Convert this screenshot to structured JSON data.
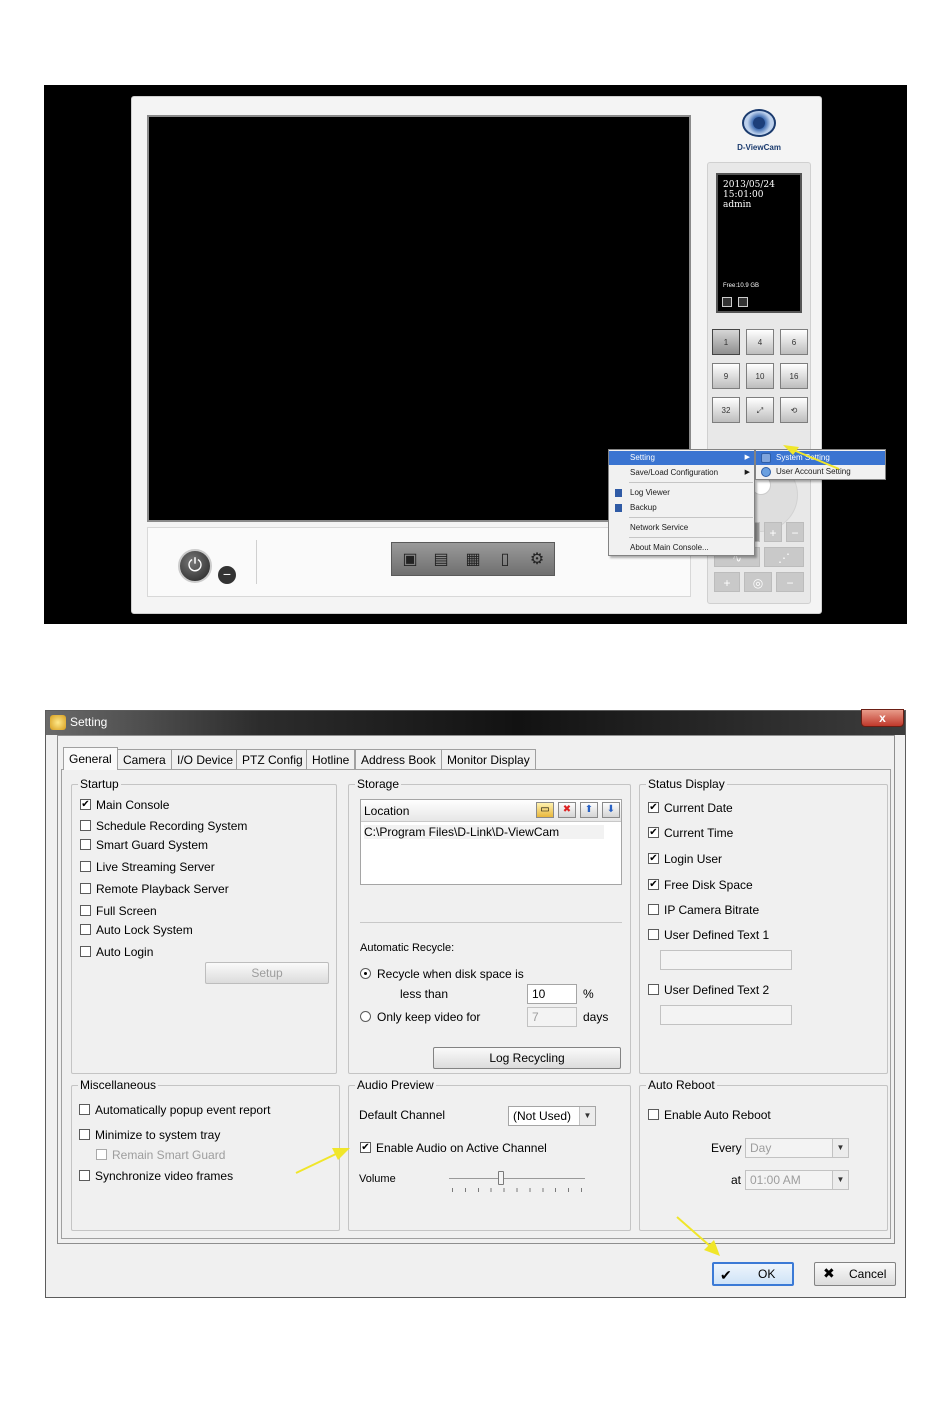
{
  "console": {
    "logo_text": "D-ViewCam",
    "info": {
      "date": "2013/05/24",
      "time": "15:01:00",
      "user": "admin",
      "free_space": "Free:10.9 GB"
    },
    "layout_buttons": [
      "1",
      "4",
      "6",
      "9",
      "10",
      "16",
      "32",
      "",
      ""
    ],
    "power_icon": "power-icon",
    "toolbar_icons": [
      "record-playback-icon",
      "clapperboard-icon",
      "schedule-icon",
      "document-icon",
      "gear-icon"
    ]
  },
  "context_menu": {
    "items": [
      {
        "label": "Setting",
        "submenu": true
      },
      {
        "label": "Save/Load Configuration",
        "submenu": true
      },
      {
        "label": "Log Viewer",
        "icon": "log-icon"
      },
      {
        "label": "Backup",
        "icon": "backup-icon"
      },
      {
        "label": "Network Service"
      },
      {
        "label": "About Main Console..."
      }
    ],
    "submenu": [
      "System Setting",
      "User Account Setting"
    ]
  },
  "dialog": {
    "title": "Setting",
    "close_label": "x",
    "tabs": [
      "General",
      "Camera",
      "I/O Device",
      "PTZ Config",
      "Hotline",
      "Address Book",
      "Monitor Display"
    ],
    "active_tab": "General",
    "startup": {
      "label": "Startup",
      "items": [
        {
          "label": "Main Console",
          "checked": true
        },
        {
          "label": "Schedule Recording System",
          "checked": false
        },
        {
          "label": "Smart Guard System",
          "checked": false
        },
        {
          "label": "Live Streaming Server",
          "checked": false
        },
        {
          "label": "Remote Playback Server",
          "checked": false
        },
        {
          "label": "Full Screen",
          "checked": false
        },
        {
          "label": "Auto Lock System",
          "checked": false
        },
        {
          "label": "Auto Login",
          "checked": false
        }
      ],
      "setup_button": "Setup"
    },
    "storage": {
      "label": "Storage",
      "column_header": "Location",
      "paths": [
        "C:\\Program Files\\D-Link\\D-ViewCam"
      ],
      "auto_recycle_label": "Automatic Recycle:",
      "recycle_when_label": "Recycle when disk space is",
      "less_than_label": "less than",
      "percent_value": "10",
      "percent_unit": "%",
      "only_keep_label": "Only keep video for",
      "days_value": "7",
      "days_unit": "days",
      "log_recycling_button": "Log Recycling"
    },
    "status_display": {
      "label": "Status Display",
      "items": [
        {
          "label": "Current Date",
          "checked": true
        },
        {
          "label": "Current Time",
          "checked": true
        },
        {
          "label": "Login User",
          "checked": true
        },
        {
          "label": "Free Disk Space",
          "checked": true
        },
        {
          "label": "IP Camera Bitrate",
          "checked": false
        },
        {
          "label": "User Defined Text 1",
          "checked": false
        },
        {
          "label": "User Defined Text 2",
          "checked": false
        }
      ]
    },
    "misc": {
      "label": "Miscellaneous",
      "items": [
        {
          "label": "Automatically popup event report",
          "checked": false
        },
        {
          "label": "Minimize to system tray",
          "checked": false
        },
        {
          "label": "Remain Smart Guard",
          "checked": false
        },
        {
          "label": "Synchronize video frames",
          "checked": false
        }
      ]
    },
    "audio": {
      "label": "Audio Preview",
      "default_channel_label": "Default Channel",
      "default_channel_value": "(Not Used)",
      "enable_audio_label": "Enable Audio on Active Channel",
      "enable_audio_checked": true,
      "volume_label": "Volume",
      "volume_level": 0.38
    },
    "auto_reboot": {
      "label": "Auto Reboot",
      "enable_label": "Enable Auto Reboot",
      "every_label": "Every",
      "every_value": "Day",
      "at_label": "at",
      "at_value": "01:00 AM"
    },
    "ok_button": "OK",
    "cancel_button": "Cancel",
    "accent_color": "#3a74d1",
    "arrow_color": "#f0e62a"
  }
}
